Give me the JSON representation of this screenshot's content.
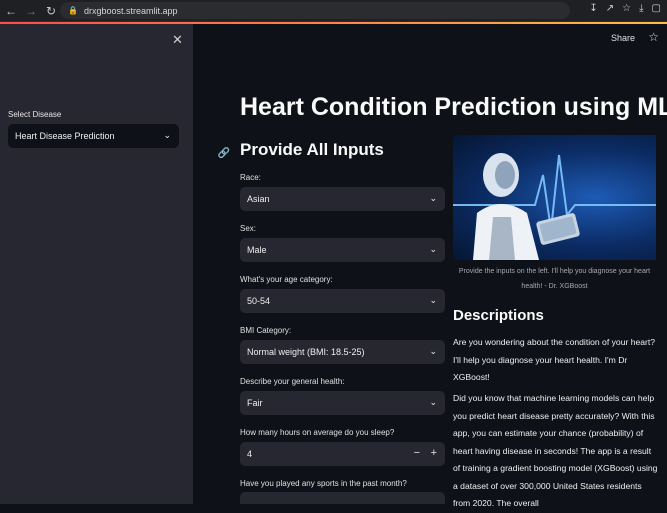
{
  "browser": {
    "url": "drxgboost.streamlit.app"
  },
  "sidebar": {
    "select_label": "Select Disease",
    "select_value": "Heart Disease Prediction"
  },
  "header": {
    "share_label": "Share"
  },
  "main": {
    "title": "Heart Condition Prediction using ML",
    "inputs_heading": "Provide All Inputs",
    "fields": [
      {
        "label": "Race:",
        "value": "Asian"
      },
      {
        "label": "Sex:",
        "value": "Male"
      },
      {
        "label": "What's your age category:",
        "value": "50-54"
      },
      {
        "label": "BMI Category:",
        "value": "Normal weight (BMI: 18.5-25)"
      },
      {
        "label": "Describe your general health:",
        "value": "Fair"
      }
    ],
    "sleep": {
      "label": "How many hours on average do you sleep?",
      "value": "4"
    },
    "sports_label": "Have you played any sports in the past month?"
  },
  "right": {
    "caption": "Provide the inputs on the left. I'll help you diagnose your heart health! - Dr. XGBoost",
    "desc_title": "Descriptions",
    "para1": "Are you wondering about the condition of your heart? I'll help you diagnose your heart health. I'm Dr XGBoost!",
    "para2": "Did you know that machine learning models can help you predict heart disease pretty accurately? With this app, you can estimate your chance (probability) of heart having disease in seconds! The app is a result of training a gradient boosting model (XGBoost) using a dataset of over 300,000 United States residents from 2020. The overall"
  }
}
